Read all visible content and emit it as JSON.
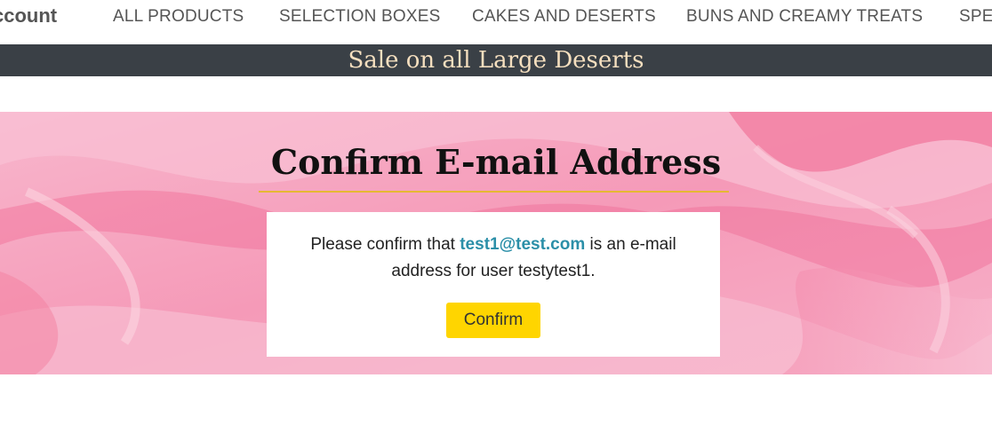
{
  "nav": {
    "account_label": "ccount",
    "items": [
      "ALL PRODUCTS",
      "SELECTION BOXES",
      "CAKES AND DESERTS",
      "BUNS AND CREAMY TREATS",
      "SPEC"
    ]
  },
  "banner": {
    "text": "Sale on all Large Deserts"
  },
  "page": {
    "title": "Confirm E-mail Address",
    "message_prefix": "Please confirm that ",
    "email": "test1@test.com",
    "message_suffix": " is an e-mail address for user testytest1.",
    "confirm_label": "Confirm"
  },
  "colors": {
    "banner_bg": "#3a4046",
    "banner_text": "#f5dfbf",
    "accent_rule": "#e6b833",
    "link": "#2b8fa8",
    "button": "#ffd500",
    "hero_pink": "#f7a9c3"
  }
}
